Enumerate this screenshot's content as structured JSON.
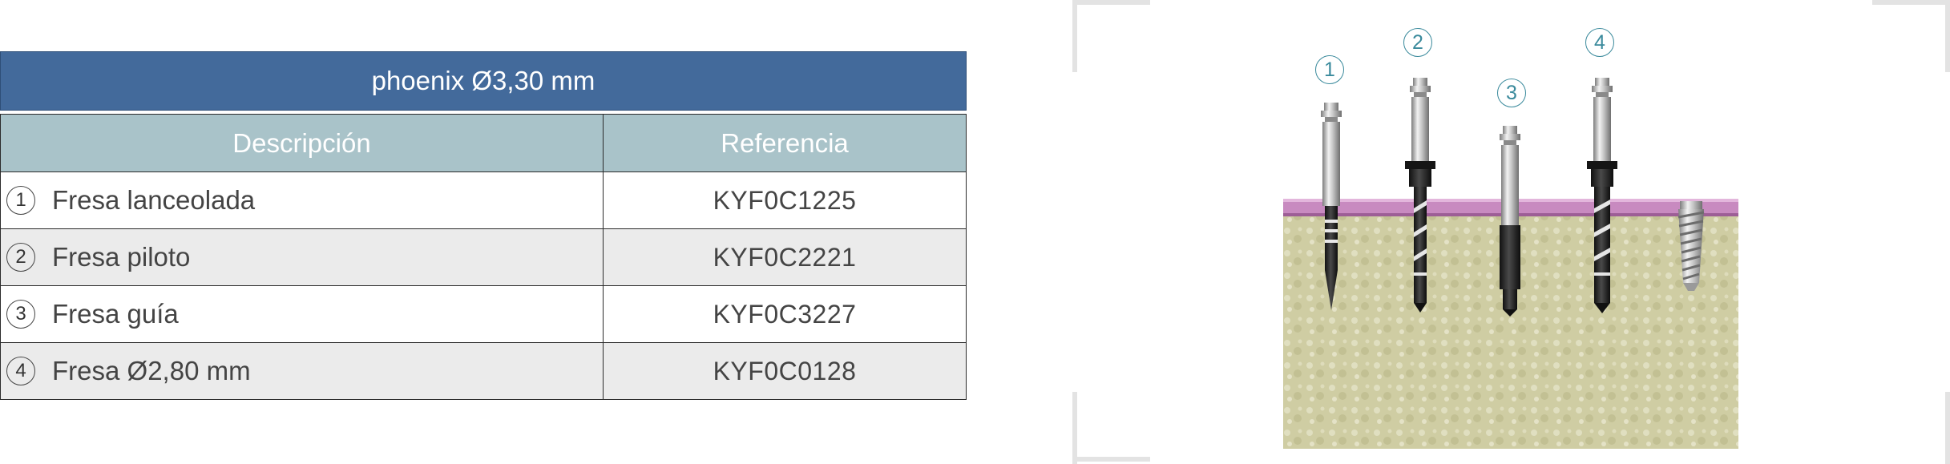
{
  "table": {
    "title": "phoenix Ø3,30 mm",
    "headers": {
      "description": "Descripción",
      "reference": "Referencia"
    },
    "rows": [
      {
        "number": "1",
        "description": "Fresa lanceolada",
        "reference": "KYF0C1225"
      },
      {
        "number": "2",
        "description": "Fresa piloto",
        "reference": "KYF0C2221"
      },
      {
        "number": "3",
        "description": "Fresa guía",
        "reference": "KYF0C3227"
      },
      {
        "number": "4",
        "description": "Fresa Ø2,80 mm",
        "reference": "KYF0C0128"
      }
    ]
  },
  "illustration": {
    "markers": [
      "1",
      "2",
      "3",
      "4"
    ],
    "colors": {
      "header_blue": "#436a9b",
      "subheader_teal": "#a9c3c9",
      "gingiva_pink": "#c88ac0",
      "bone": "#cfcda3",
      "marker_teal": "#3a8a9c"
    }
  }
}
